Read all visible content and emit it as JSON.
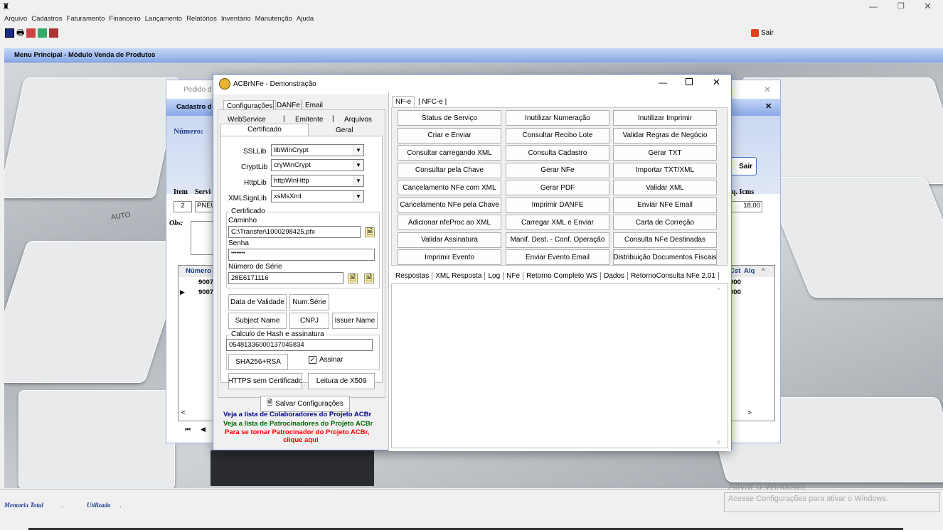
{
  "app": {
    "menus": [
      "Arquivo",
      "Cadastros",
      "Faturamento",
      "Financeiro",
      "Lançamento",
      "Relatórios",
      "Inventário",
      "Manutenção",
      "Ajuda"
    ],
    "exit_label": "Sair",
    "panel_title": "Menu Principal - Módulo Venda de Produtos"
  },
  "status": {
    "memoria": "Memoria Total",
    "memoria_val": ".",
    "utilizado": "Utilizado",
    "utilizado_val": "."
  },
  "watermark": {
    "title": "Ativar o Windows",
    "subtitle": "Acesse Configurações para ativar o Windows."
  },
  "bg_form": {
    "title_partial": "Pedido d",
    "inner_title": "Cadastro d",
    "numero": "Número:",
    "item": "Item",
    "servi": "Servi",
    "item_no": "2",
    "item_desc": "PNEU",
    "obs": "Obs:",
    "numero_col": "Número",
    "row1": "9007",
    "row2": "9007",
    "sair": "Sair",
    "icms_hdr": "q. Icms",
    "icms_val": "18,00",
    "cst": "Cst",
    "alq": "Alq",
    "row_val1": "000",
    "row_val2": "000"
  },
  "dialog": {
    "title": "ACBrNFe - Demonstração",
    "left_tabs": [
      "Configurações",
      "DANFe",
      "Email"
    ],
    "sub_tabs_row1": [
      "WebService",
      "Emitente",
      "Arquivos"
    ],
    "sub_tabs_row2": [
      "Certificado",
      "Geral"
    ],
    "ssllib_label": "SSLLib",
    "ssllib": "libWinCrypt",
    "cryptlib_label": "CryptLib",
    "cryptlib": "cryWinCrypt",
    "httplib_label": "HttpLib",
    "httplib": "httpWinHttp",
    "xmlsign_label": "XMLSignLib",
    "xmlsign": "xsMsXml",
    "cert_group": "Certificado",
    "caminho_label": "Caminho",
    "caminho": "C:\\Transfer\\1000298425.pfx",
    "senha_label": "Senha",
    "senha": "••••••••",
    "serie_label": "Número de Série",
    "serie": "28E6171116",
    "btn_validade": "Data de Validade",
    "btn_numserie": "Num.Série",
    "btn_subject": "Subject Name",
    "btn_cnpj": "CNPJ",
    "btn_issuer": "Issuer Name",
    "hash_group": "Calculo de Hash e assinatura",
    "hash_value": "05481336000137045834",
    "btn_sha": "SHA256+RSA",
    "assinar": "Assinar",
    "btn_https": "HTTPS sem Certificado",
    "btn_x509": "Leitura de X509",
    "btn_salvar": "Salvar Configurações",
    "link_colab": "Veja a lista de Colaboradores do Projeto ACBr",
    "link_patro": "Veja a lista de Patrocinadores do Projeto ACBr",
    "link_tornar1": "Para se tornar Patrocinador do Projeto ACBr,",
    "link_tornar2": "clique aqui",
    "right_tabs": [
      "NF-e",
      "NFC-e"
    ],
    "buttons": [
      [
        "Status de Serviço",
        "Inutilizar Numeração",
        "Inutilizar Imprimir"
      ],
      [
        "Criar e Enviar",
        "Consultar Recibo Lote",
        "Validar Regras de Negócio"
      ],
      [
        "Consultar carregando XML",
        "Consulta Cadastro",
        "Gerar TXT"
      ],
      [
        "Consultar pela Chave",
        "Gerar NFe",
        "Importar TXT/XML"
      ],
      [
        "Cancelamento NFe com XML",
        "Gerar PDF",
        "Validar XML"
      ],
      [
        "Cancelamento NFe pela Chave",
        "Imprimir DANFE",
        "Enviar NFe Email"
      ],
      [
        "Adicionar nfeProc ao XML",
        "Carregar XML e Enviar",
        "Carta de Correção"
      ],
      [
        "Validar Assinatura",
        "Manif. Dest. - Conf. Operação",
        "Consulta NFe Destinadas"
      ],
      [
        "Imprimir Evento",
        "Enviar Evento Email",
        "Distribuição Documentos Fiscais"
      ]
    ],
    "resp_tabs": [
      "Respostas",
      "XML Resposta",
      "Log",
      "NFe",
      "Retorno Completo WS",
      "Dados",
      "RetornoConsulta NFe 2.01"
    ]
  },
  "colors": {
    "title_blue": "#5b87d8",
    "panel_blue": "#cbd8f2",
    "link_blue": "#00008b",
    "link_green": "#006400",
    "link_red": "#ff0000"
  }
}
